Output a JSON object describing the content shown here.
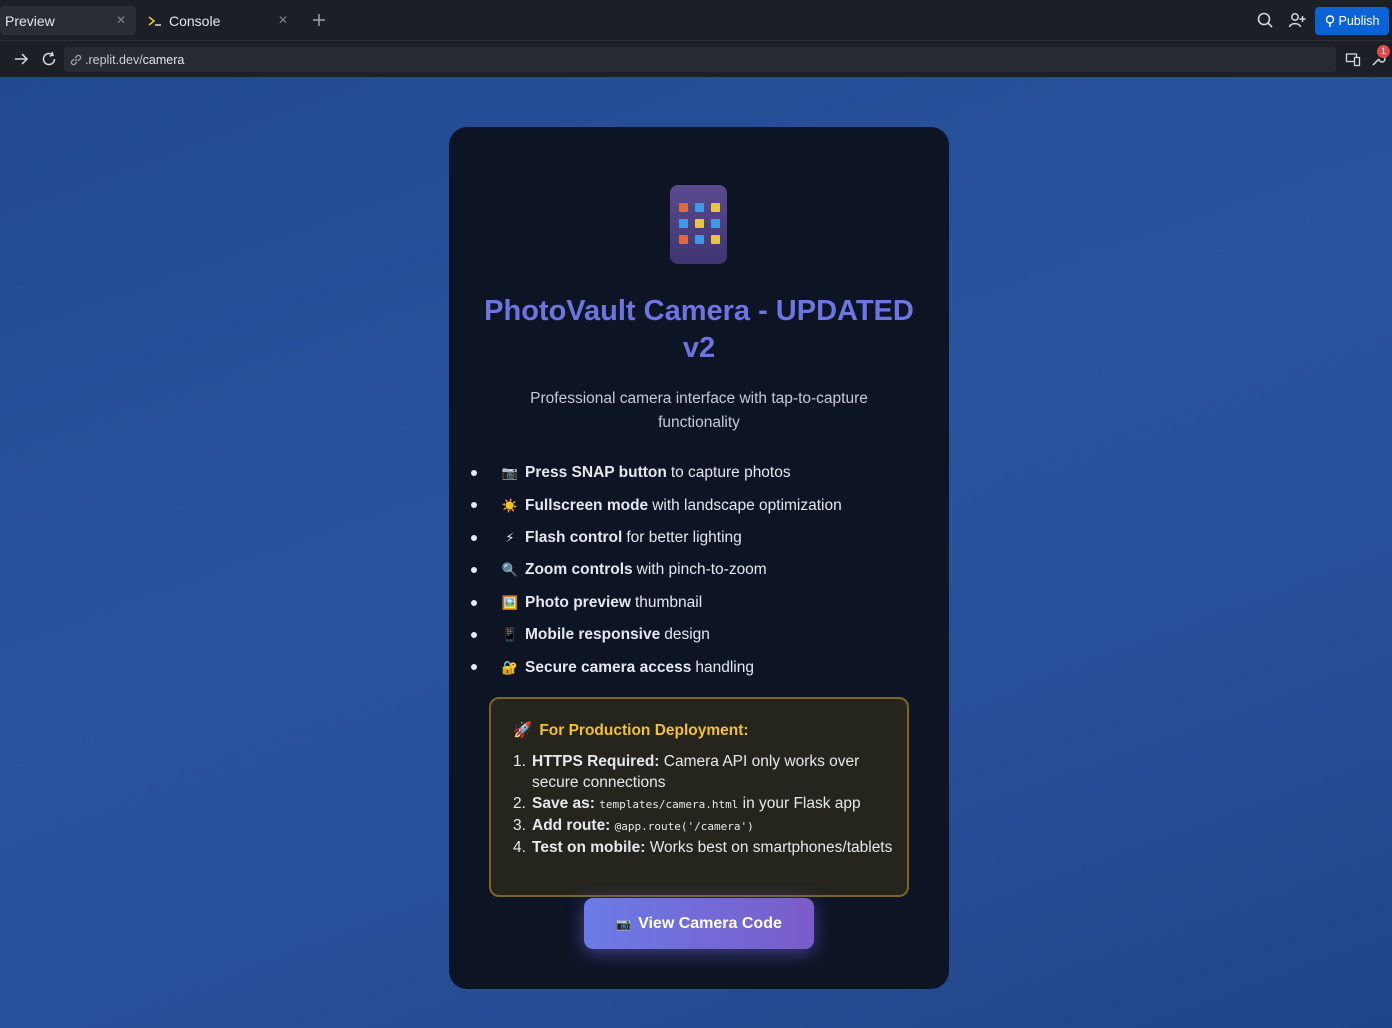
{
  "tabs": [
    {
      "label": "Preview",
      "active": true
    },
    {
      "label": "Console",
      "active": false
    }
  ],
  "toolbar": {
    "publish_label": "Publish",
    "icons": [
      "search-icon",
      "invite-user-icon",
      "publish-icon"
    ]
  },
  "address_bar": {
    "url_host": ".replit.dev/",
    "url_path": "camera",
    "badge_count": "1"
  },
  "card": {
    "title": "PhotoVault Camera - UPDATED v2",
    "subtitle": "Professional camera interface with tap-to-capture functionality",
    "features": [
      {
        "emoji": "📷",
        "bold": "Press SNAP button",
        "rest": "to capture photos"
      },
      {
        "emoji": "☀️",
        "bold": "Fullscreen mode",
        "rest": "with landscape optimization"
      },
      {
        "emoji": "⚡",
        "bold": "Flash control",
        "rest": "for better lighting"
      },
      {
        "emoji": "🔍",
        "bold": "Zoom controls",
        "rest": "with pinch-to-zoom"
      },
      {
        "emoji": "🖼️",
        "bold": "Photo preview",
        "rest": "thumbnail"
      },
      {
        "emoji": "📱",
        "bold": "Mobile responsive",
        "rest": "design"
      },
      {
        "emoji": "🔐",
        "bold": "Secure camera access",
        "rest": "handling"
      }
    ],
    "deployment": {
      "emoji": "🚀",
      "heading": "For Production Deployment:",
      "steps": [
        {
          "num": "1.",
          "bold": "HTTPS Required:",
          "text": "Camera API only works over secure connections",
          "code": ""
        },
        {
          "num": "2.",
          "bold": "Save as:",
          "code": "templates/camera.html",
          "text": "in your Flask app"
        },
        {
          "num": "3.",
          "bold": "Add route:",
          "code": "@app.route('/camera')",
          "text": ""
        },
        {
          "num": "4.",
          "bold": "Test on mobile:",
          "text": "Works best on smartphones/tablets",
          "code": ""
        }
      ]
    },
    "button": {
      "emoji": "📷",
      "label": "View Camera Code"
    }
  },
  "colors": {
    "accent_title": "#6f74e3",
    "publish_button": "#0b61d6",
    "deploy_heading": "#f2c230",
    "page_gradient": "#2a54a0"
  }
}
